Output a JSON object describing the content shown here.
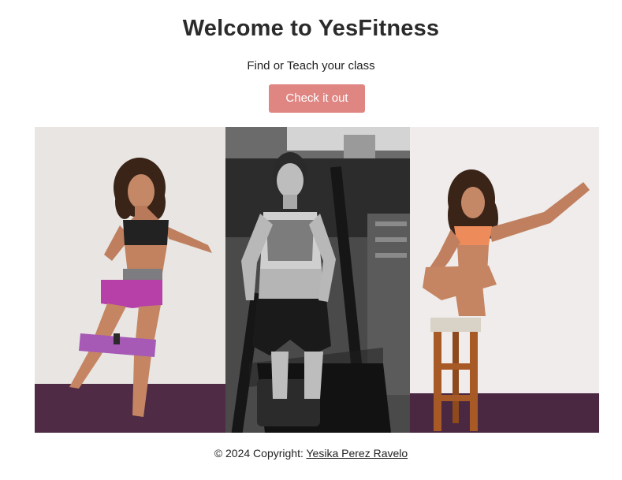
{
  "hero": {
    "title": "Welcome to YesFitness",
    "subtitle": "Find or Teach your class",
    "cta_label": "Check it out"
  },
  "gallery": {
    "photos": [
      {
        "subject": "woman in sports bra doing resistance band side step"
      },
      {
        "subject": "woman riding elliptical machine, black and white"
      },
      {
        "subject": "woman balancing on wooden stool in yoga pose"
      }
    ]
  },
  "footer": {
    "copyright_prefix": "© 2024 Copyright: ",
    "author_link": "Yesika Perez Ravelo"
  },
  "colors": {
    "accent": "#df8683",
    "text": "#2b2b2b",
    "background": "#ffffff"
  }
}
